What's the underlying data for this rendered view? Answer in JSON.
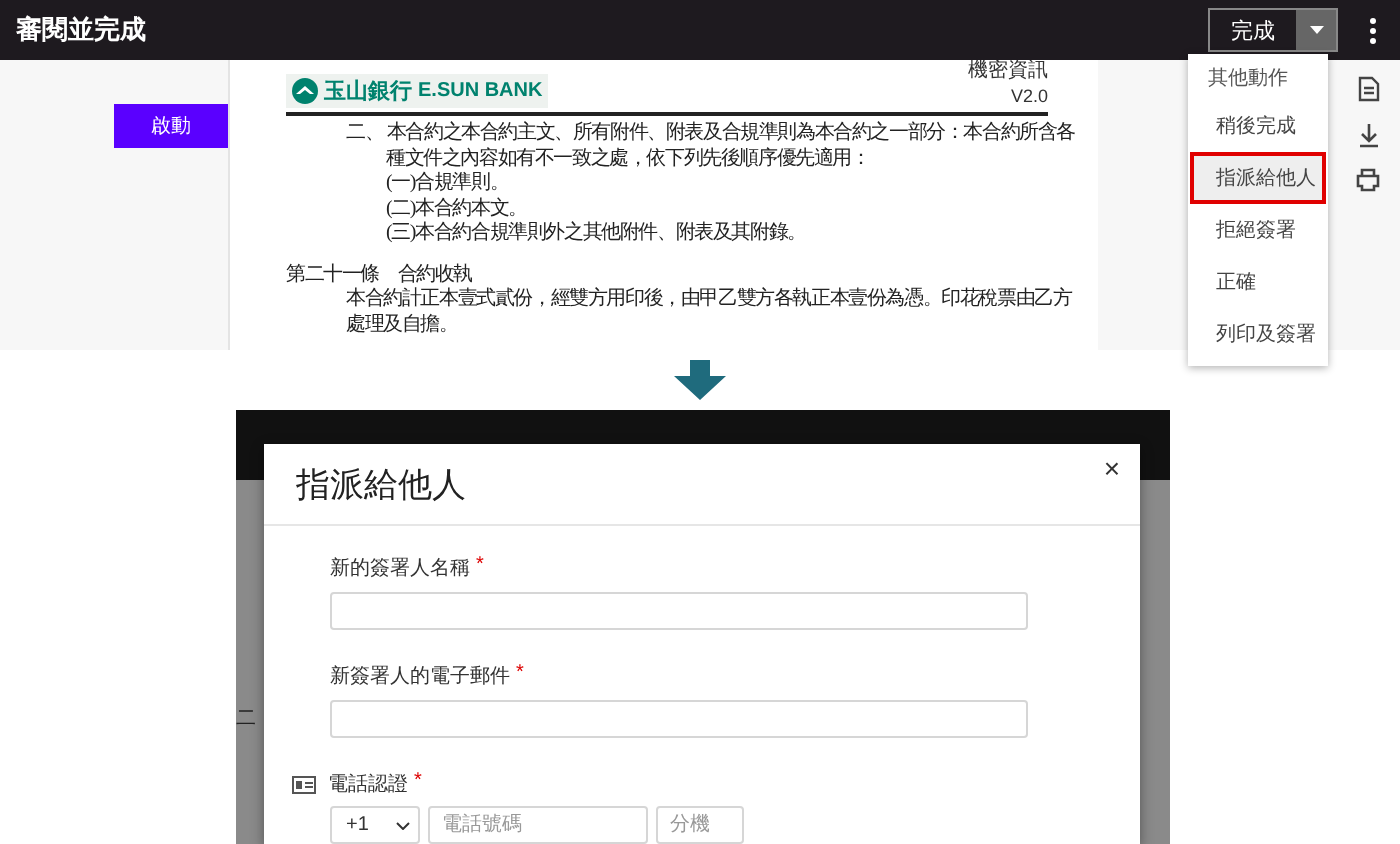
{
  "top": {
    "title": "審閱並完成",
    "start_button": "啟動",
    "document": {
      "logo_name": "玉山銀行",
      "logo_latin": "E.SUN BANK",
      "classification": "機密資訊",
      "version": "V2.0",
      "lines": [
        {
          "kind": "clause",
          "text": "二、 本合約之本合約主文、所有附件、附表及合規準則為本合約之一部分：本合約所含各"
        },
        {
          "kind": "clause-cont",
          "text": "種文件之內容如有不一致之處，依下列先後順序優先適用："
        },
        {
          "kind": "sub",
          "text": "(一)合規準則。"
        },
        {
          "kind": "sub",
          "text": "(二)本合約本文。"
        },
        {
          "kind": "sub",
          "text": "(三)本合約合規準則外之其他附件、附表及其附錄。"
        },
        {
          "kind": "article",
          "text": "第二十一條　合約收執"
        },
        {
          "kind": "body",
          "text": "本合約計正本壹式貳份，經雙方用印後，由甲乙雙方各執正本壹份為憑。印花稅票由乙方"
        },
        {
          "kind": "body",
          "text": "處理及自擔。"
        }
      ]
    },
    "finish_button": "完成",
    "menu": {
      "header": "其他動作",
      "items": [
        {
          "label": "稍後完成",
          "selected": false
        },
        {
          "label": "指派給他人",
          "selected": true
        },
        {
          "label": "拒絕簽署",
          "selected": false
        },
        {
          "label": "正確",
          "selected": false
        },
        {
          "label": "列印及簽署",
          "selected": false
        }
      ]
    }
  },
  "bottom": {
    "backdrop_text": "二",
    "dialog": {
      "title": "指派給他人",
      "close": "×",
      "fields": [
        {
          "label": "新的簽署人名稱",
          "required_mark": "*"
        },
        {
          "label": "新簽署人的電子郵件",
          "required_mark": "*"
        }
      ],
      "phone": {
        "label": "電話認證",
        "required_mark": "*",
        "country_code": "+1",
        "number_placeholder": "電話號碼",
        "extension_placeholder": "分機"
      }
    }
  }
}
